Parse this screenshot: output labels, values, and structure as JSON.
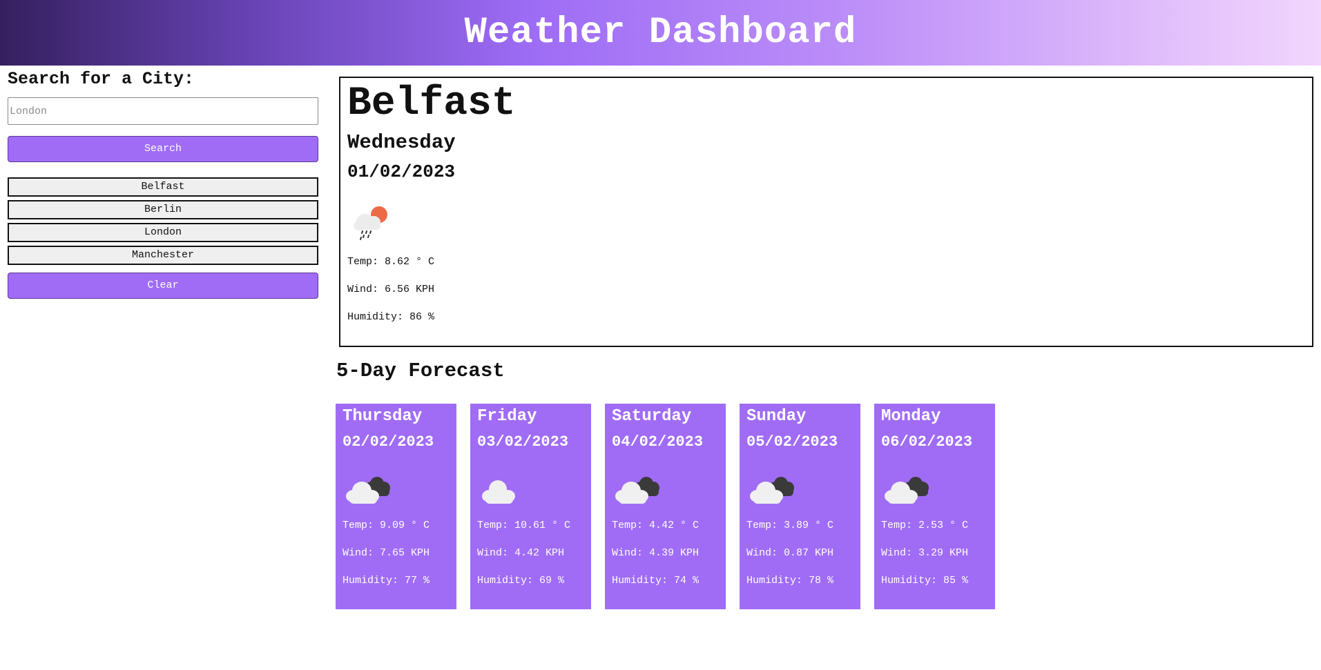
{
  "header": {
    "title": "Weather Dashboard"
  },
  "sidebar": {
    "heading": "Search for a City:",
    "search_placeholder": "London",
    "search_label": "Search",
    "history": [
      "Belfast",
      "Berlin",
      "London",
      "Manchester"
    ],
    "clear_label": "Clear"
  },
  "current": {
    "city": "Belfast",
    "day": "Wednesday",
    "date": "01/02/2023",
    "icon": "sun-cloud-rain-icon",
    "temp": "Temp: 8.62 ° C",
    "wind": "Wind: 6.56 KPH",
    "humidity": "Humidity: 86 %"
  },
  "forecast": {
    "title": "5-Day Forecast",
    "days": [
      {
        "day": "Thursday",
        "date": "02/02/2023",
        "icon": "broken-clouds-icon",
        "temp": "Temp: 9.09 ° C",
        "wind": "Wind: 7.65 KPH",
        "humidity": "Humidity: 77 %"
      },
      {
        "day": "Friday",
        "date": "03/02/2023",
        "icon": "cloud-icon",
        "temp": "Temp: 10.61 ° C",
        "wind": "Wind: 4.42 KPH",
        "humidity": "Humidity: 69 %"
      },
      {
        "day": "Saturday",
        "date": "04/02/2023",
        "icon": "broken-clouds-icon",
        "temp": "Temp: 4.42 ° C",
        "wind": "Wind: 4.39 KPH",
        "humidity": "Humidity: 74 %"
      },
      {
        "day": "Sunday",
        "date": "05/02/2023",
        "icon": "broken-clouds-icon",
        "temp": "Temp: 3.89 ° C",
        "wind": "Wind: 0.87 KPH",
        "humidity": "Humidity: 78 %"
      },
      {
        "day": "Monday",
        "date": "06/02/2023",
        "icon": "broken-clouds-icon",
        "temp": "Temp: 2.53 ° C",
        "wind": "Wind: 3.29 KPH",
        "humidity": "Humidity: 85 %"
      }
    ]
  },
  "colors": {
    "accent": "#a06cf6",
    "header_start": "#35205e",
    "header_end": "#f2d6fd"
  }
}
